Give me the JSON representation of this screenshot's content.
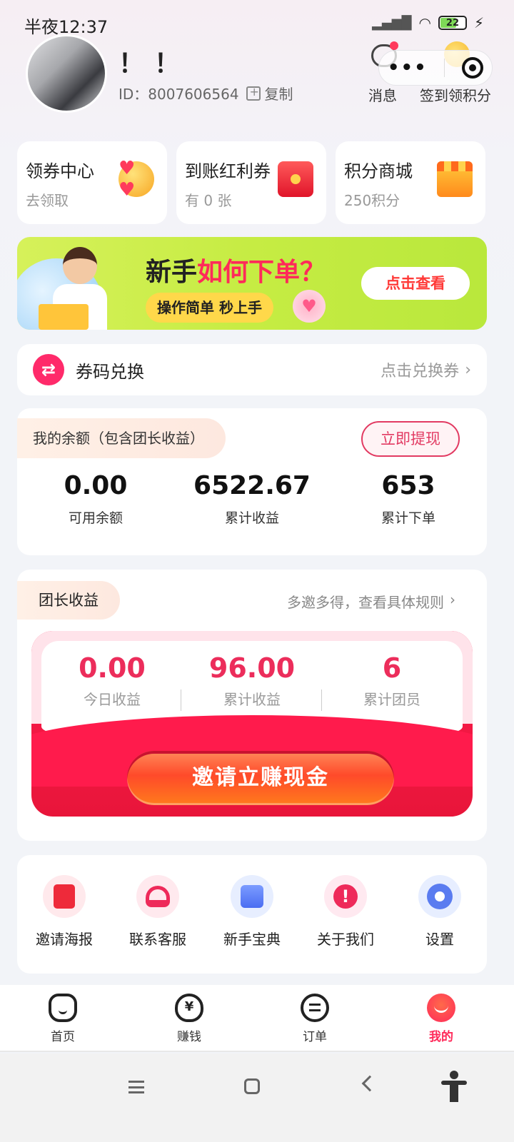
{
  "status_bar": {
    "time": "半夜12:37",
    "battery": "22"
  },
  "header": {
    "username": "！！",
    "user_id_label": "ID：8007606564",
    "copy_label": "复制",
    "messages_label": "消息",
    "checkin_label": "签到领积分"
  },
  "quick_cards": [
    {
      "title": "领券中心",
      "subtitle": "去领取",
      "icon": "heart-eyes-face-icon"
    },
    {
      "title": "到账红利券",
      "subtitle": "有 0 张",
      "icon": "red-envelope-icon"
    },
    {
      "title": "积分商城",
      "subtitle": "250积分",
      "icon": "shop-icon"
    }
  ],
  "banner": {
    "headline_prefix": "新手",
    "headline_highlight": "如何下单？",
    "subline": "操作简单 秒上手",
    "button": "点击查看"
  },
  "coupon_exchange": {
    "title": "券码兑换",
    "action": "点击兑换券"
  },
  "balance": {
    "tag": "我的余额（包含团长收益）",
    "withdraw_button": "立即提现",
    "stats": [
      {
        "value": "0.00",
        "label": "可用余额"
      },
      {
        "value": "6522.67",
        "label": "累计收益"
      },
      {
        "value": "653",
        "label": "累计下单"
      }
    ]
  },
  "team": {
    "tag": "团长收益",
    "rule_link": "多邀多得，查看具体规则",
    "stats": [
      {
        "value": "0.00",
        "label": "今日收益"
      },
      {
        "value": "96.00",
        "label": "累计收益"
      },
      {
        "value": "6",
        "label": "累计团员"
      }
    ],
    "invite_button": "邀请立赚现金"
  },
  "tools": [
    {
      "label": "邀请海报",
      "icon": "red-envelope-icon"
    },
    {
      "label": "联系客服",
      "icon": "headset-icon"
    },
    {
      "label": "新手宝典",
      "icon": "guide-book-icon"
    },
    {
      "label": "关于我们",
      "icon": "info-icon"
    },
    {
      "label": "设置",
      "icon": "gear-icon"
    }
  ],
  "bottom_nav": [
    {
      "label": "首页",
      "icon": "home-icon"
    },
    {
      "label": "赚钱",
      "icon": "money-bag-icon"
    },
    {
      "label": "订单",
      "icon": "order-icon"
    },
    {
      "label": "我的",
      "icon": "profile-icon",
      "active": true
    }
  ],
  "colors": {
    "accent": "#ff2a5a",
    "banner": "#c6ec43",
    "team_red": "#ec2d5b"
  }
}
